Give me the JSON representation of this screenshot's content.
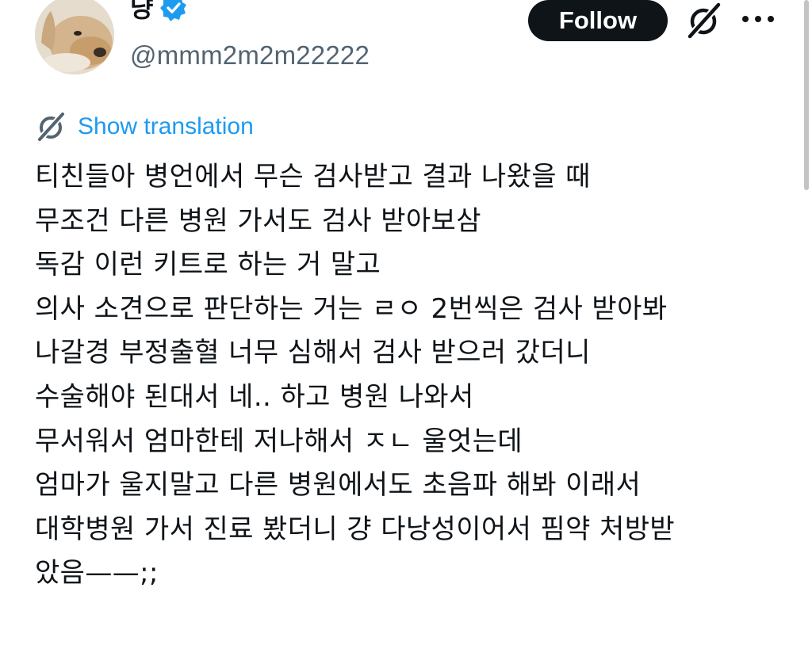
{
  "header": {
    "display_name": "냥",
    "handle": "@mmm2m2m22222",
    "follow_label": "Follow",
    "icons": {
      "avatar": "dog-photo-avatar",
      "verified": "verified-badge-icon",
      "grok": "grok-icon",
      "more": "more-options-icon"
    }
  },
  "translation": {
    "label": "Show translation",
    "icon": "translate-icon"
  },
  "tweet": {
    "lines": [
      "티친들아 병언에서 무슨 검사받고 결과 나왔을 때",
      "무조건 다른 병원 가서도 검사 받아보삼",
      "독감 이런 키트로 하는 거 말고",
      "의사 소견으로 판단하는 거는 ㄹㅇ 2번씩은 검사 받아봐",
      "나갈경 부정출혈 너무 심해서 검사 받으러 갔더니",
      "수술해야 된대서 네.. 하고 병원 나와서",
      "무서워서 엄마한테 저나해서 ㅈㄴ 울엇는데",
      "엄마가 울지말고 다른 병원에서도 초음파 해봐 이래서",
      "대학병원 가서 진료 봤더니 걍 다낭성이어서 핌약 처방받",
      "았음——;;"
    ]
  },
  "colors": {
    "text": "#0f1419",
    "secondary": "#536471",
    "link": "#1d9bf0",
    "verified": "#1d9bf0",
    "button_bg": "#0f1419",
    "button_text": "#ffffff"
  }
}
